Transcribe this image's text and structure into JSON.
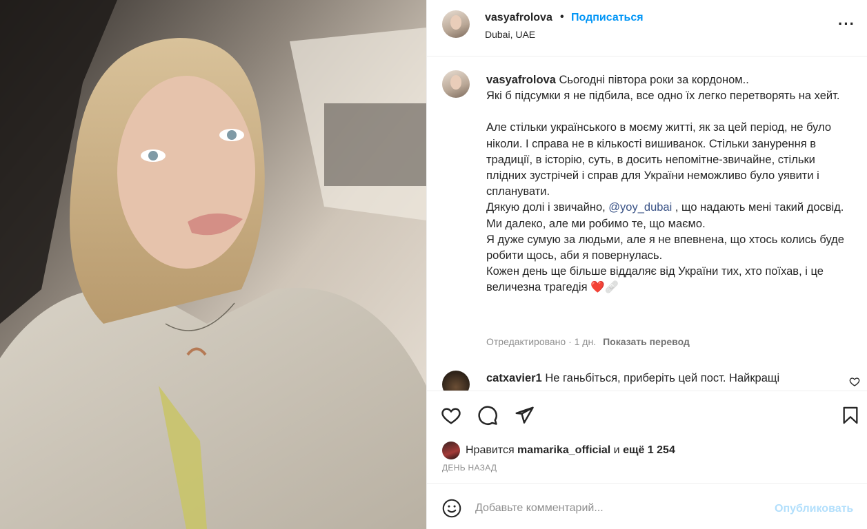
{
  "photo": {
    "alt_icon": "selfie-photo"
  },
  "header": {
    "username": "vasyafrolova",
    "separator": "•",
    "follow_label": "Подписаться",
    "location": "Dubai, UAE",
    "more_label": "···"
  },
  "caption": {
    "username": "vasyafrolova",
    "lines": [
      "Сьогодні півтора роки за кордоном..",
      "Які б підсумки я не підбила, все одно їх легко перетворять на хейт.",
      "",
      "Але стільки українського в моєму житті, як за цей період, не було ніколи. І справа не в кількості вишиванок. Стільки занурення в традиції, в історію, суть, в досить непомітне-звичайне, стільки плідних зустрічей і справ для України неможливо було уявити і спланувати.",
      "Дякую долі і звичайно, ",
      "Ми далеко, але ми робимо те, що маємо.",
      "Я дуже сумую за людьми, але я не впевнена, що хтось колись буде робити щось, аби я повернулась.",
      "Кожен день ще більше віддаляє від України тих, хто поїхав, і це величезна трагедія ❤️🩹"
    ],
    "mention": "@yoy_dubai",
    "after_mention": " , що надають мені такий досвід.",
    "edited": "Отредактировано · 1 дн.",
    "translate_label": "Показать перевод"
  },
  "comment": {
    "username": "catxavier1",
    "text": " Не ганьбіться, приберіть цей пост. Найкращі"
  },
  "likes": {
    "prefix": "Нравится ",
    "liker": "mamarika_official",
    "middle": " и ",
    "more": "ещё 1 254"
  },
  "time": "ДЕНЬ НАЗАД",
  "add_comment": {
    "placeholder": "Добавьте комментарий...",
    "publish_label": "Опубликовать"
  },
  "colors": {
    "accent": "#0095f6",
    "mention": "#385185",
    "publish_disabled": "#b2dffc",
    "heart": "#e0245e"
  }
}
